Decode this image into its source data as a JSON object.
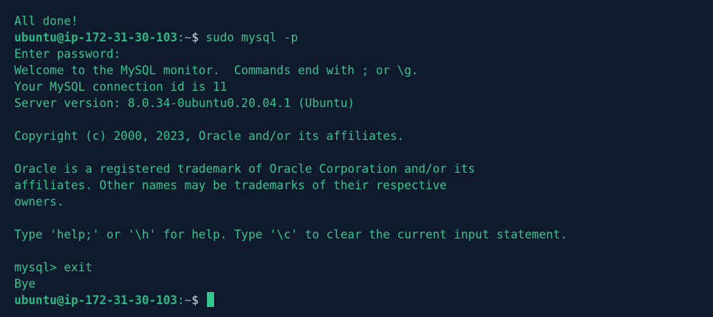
{
  "terminal": {
    "prompt": {
      "user_host": "ubuntu@ip-172-31-30-103",
      "separator": ":",
      "path": "~",
      "symbol": "$ "
    },
    "lines": [
      "All done!",
      "sudo mysql -p",
      "Enter password:",
      "Welcome to the MySQL monitor.  Commands end with ; or \\g.",
      "Your MySQL connection id is 11",
      "Server version: 8.0.34-0ubuntu0.20.04.1 (Ubuntu)",
      "",
      "Copyright (c) 2000, 2023, Oracle and/or its affiliates.",
      "",
      "Oracle is a registered trademark of Oracle Corporation and/or its",
      "affiliates. Other names may be trademarks of their respective",
      "owners.",
      "",
      "Type 'help;' or '\\h' for help. Type '\\c' to clear the current input statement.",
      "",
      "mysql> exit",
      "Bye",
      ""
    ]
  },
  "colors": {
    "background": "#0f1b2c",
    "text": "#36c48e",
    "cursor": "#31c78f"
  }
}
